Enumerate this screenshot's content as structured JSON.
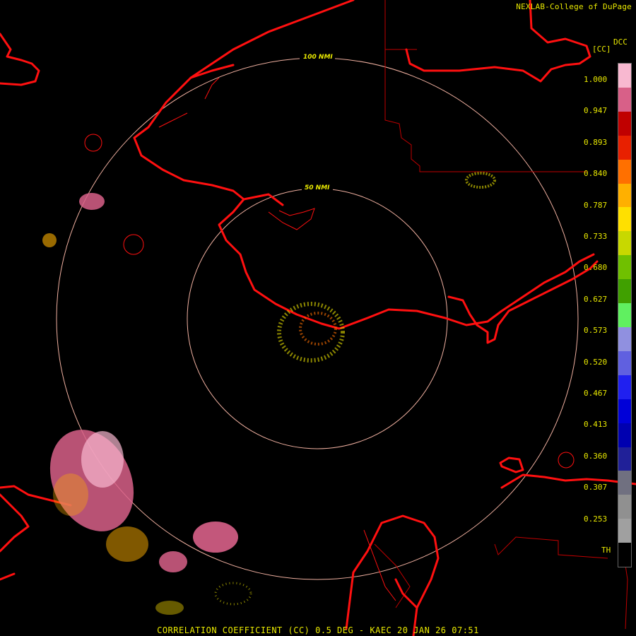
{
  "header": {
    "credit": "NEXLAB-College of DuPage"
  },
  "legend": {
    "title": "DCC",
    "unit": "[CC]",
    "ticks": [
      "1.000",
      "0.947",
      "0.893",
      "0.840",
      "0.787",
      "0.733",
      "0.680",
      "0.627",
      "0.573",
      "0.520",
      "0.467",
      "0.413",
      "0.360",
      "0.307",
      "0.253",
      "TH"
    ],
    "colors": [
      "#f8b8d0",
      "#d86088",
      "#c00000",
      "#e82000",
      "#ff7000",
      "#ffb000",
      "#ffe000",
      "#c8d800",
      "#70c000",
      "#40a000",
      "#60f060",
      "#9090e0",
      "#6060e0",
      "#2020f0",
      "#0000d8",
      "#0000b0",
      "#202098",
      "#707080",
      "#909090",
      "#a0a0a0",
      "#000000"
    ]
  },
  "rings": [
    {
      "label": "50 NMI",
      "radius_nmi": 50
    },
    {
      "label": "100 NMI",
      "radius_nmi": 100
    }
  ],
  "footer": {
    "caption": "CORRELATION COEFFICIENT (CC) 0.5 DEG - KAEC 20 JAN 26 07:51"
  }
}
